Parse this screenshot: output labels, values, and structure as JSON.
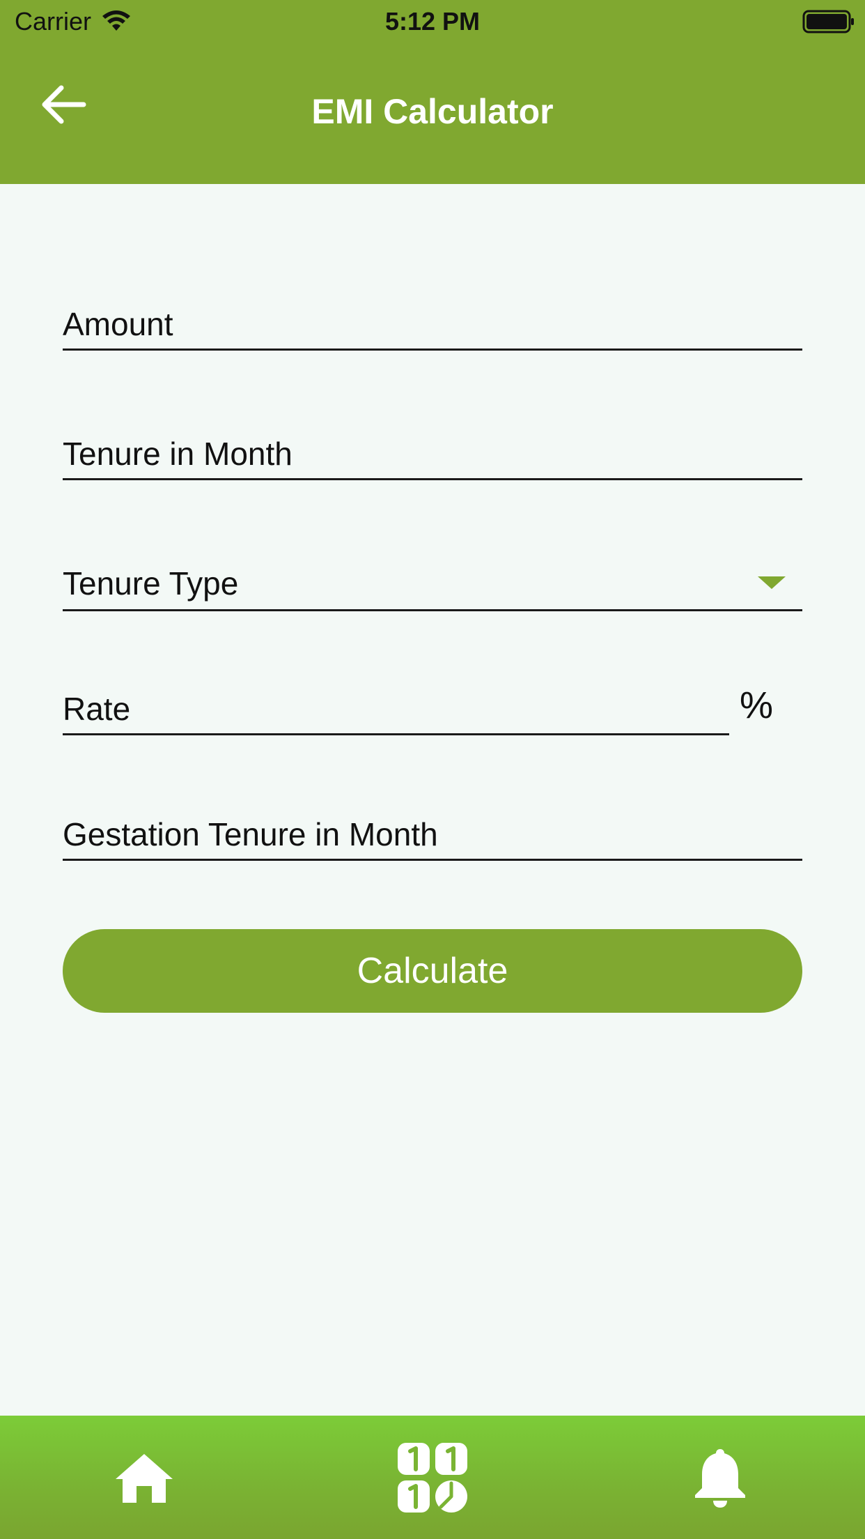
{
  "status_bar": {
    "carrier": "Carrier",
    "time": "5:12 PM"
  },
  "header": {
    "title": "EMI Calculator",
    "back_icon": "arrow-left-icon"
  },
  "form": {
    "amount": {
      "placeholder": "Amount",
      "value": ""
    },
    "tenure_month": {
      "placeholder": "Tenure in Month",
      "value": ""
    },
    "tenure_type": {
      "label": "Tenure Type",
      "icon": "dropdown-arrow-icon"
    },
    "rate": {
      "placeholder": "Rate",
      "value": "",
      "suffix": "%"
    },
    "gestation_tenure": {
      "placeholder": "Gestation Tenure in Month",
      "value": ""
    },
    "calculate_label": "Calculate"
  },
  "bottom_nav": {
    "items": [
      {
        "icon": "home-icon"
      },
      {
        "icon": "calculator-icon"
      },
      {
        "icon": "bell-icon"
      }
    ]
  },
  "colors": {
    "accent": "#80a830",
    "background": "#f3f9f6",
    "nav_bar": "#7ab433"
  }
}
